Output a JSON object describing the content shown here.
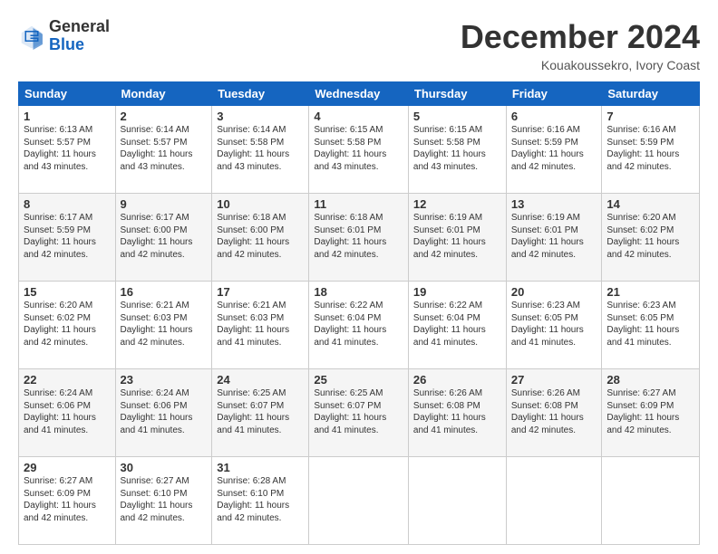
{
  "header": {
    "logo_general": "General",
    "logo_blue": "Blue",
    "month_title": "December 2024",
    "location": "Kouakoussekro, Ivory Coast"
  },
  "weekdays": [
    "Sunday",
    "Monday",
    "Tuesday",
    "Wednesday",
    "Thursday",
    "Friday",
    "Saturday"
  ],
  "weeks": [
    [
      {
        "day": "1",
        "info": "Sunrise: 6:13 AM\nSunset: 5:57 PM\nDaylight: 11 hours and 43 minutes."
      },
      {
        "day": "2",
        "info": "Sunrise: 6:14 AM\nSunset: 5:57 PM\nDaylight: 11 hours and 43 minutes."
      },
      {
        "day": "3",
        "info": "Sunrise: 6:14 AM\nSunset: 5:58 PM\nDaylight: 11 hours and 43 minutes."
      },
      {
        "day": "4",
        "info": "Sunrise: 6:15 AM\nSunset: 5:58 PM\nDaylight: 11 hours and 43 minutes."
      },
      {
        "day": "5",
        "info": "Sunrise: 6:15 AM\nSunset: 5:58 PM\nDaylight: 11 hours and 43 minutes."
      },
      {
        "day": "6",
        "info": "Sunrise: 6:16 AM\nSunset: 5:59 PM\nDaylight: 11 hours and 42 minutes."
      },
      {
        "day": "7",
        "info": "Sunrise: 6:16 AM\nSunset: 5:59 PM\nDaylight: 11 hours and 42 minutes."
      }
    ],
    [
      {
        "day": "8",
        "info": "Sunrise: 6:17 AM\nSunset: 5:59 PM\nDaylight: 11 hours and 42 minutes."
      },
      {
        "day": "9",
        "info": "Sunrise: 6:17 AM\nSunset: 6:00 PM\nDaylight: 11 hours and 42 minutes."
      },
      {
        "day": "10",
        "info": "Sunrise: 6:18 AM\nSunset: 6:00 PM\nDaylight: 11 hours and 42 minutes."
      },
      {
        "day": "11",
        "info": "Sunrise: 6:18 AM\nSunset: 6:01 PM\nDaylight: 11 hours and 42 minutes."
      },
      {
        "day": "12",
        "info": "Sunrise: 6:19 AM\nSunset: 6:01 PM\nDaylight: 11 hours and 42 minutes."
      },
      {
        "day": "13",
        "info": "Sunrise: 6:19 AM\nSunset: 6:01 PM\nDaylight: 11 hours and 42 minutes."
      },
      {
        "day": "14",
        "info": "Sunrise: 6:20 AM\nSunset: 6:02 PM\nDaylight: 11 hours and 42 minutes."
      }
    ],
    [
      {
        "day": "15",
        "info": "Sunrise: 6:20 AM\nSunset: 6:02 PM\nDaylight: 11 hours and 42 minutes."
      },
      {
        "day": "16",
        "info": "Sunrise: 6:21 AM\nSunset: 6:03 PM\nDaylight: 11 hours and 42 minutes."
      },
      {
        "day": "17",
        "info": "Sunrise: 6:21 AM\nSunset: 6:03 PM\nDaylight: 11 hours and 41 minutes."
      },
      {
        "day": "18",
        "info": "Sunrise: 6:22 AM\nSunset: 6:04 PM\nDaylight: 11 hours and 41 minutes."
      },
      {
        "day": "19",
        "info": "Sunrise: 6:22 AM\nSunset: 6:04 PM\nDaylight: 11 hours and 41 minutes."
      },
      {
        "day": "20",
        "info": "Sunrise: 6:23 AM\nSunset: 6:05 PM\nDaylight: 11 hours and 41 minutes."
      },
      {
        "day": "21",
        "info": "Sunrise: 6:23 AM\nSunset: 6:05 PM\nDaylight: 11 hours and 41 minutes."
      }
    ],
    [
      {
        "day": "22",
        "info": "Sunrise: 6:24 AM\nSunset: 6:06 PM\nDaylight: 11 hours and 41 minutes."
      },
      {
        "day": "23",
        "info": "Sunrise: 6:24 AM\nSunset: 6:06 PM\nDaylight: 11 hours and 41 minutes."
      },
      {
        "day": "24",
        "info": "Sunrise: 6:25 AM\nSunset: 6:07 PM\nDaylight: 11 hours and 41 minutes."
      },
      {
        "day": "25",
        "info": "Sunrise: 6:25 AM\nSunset: 6:07 PM\nDaylight: 11 hours and 41 minutes."
      },
      {
        "day": "26",
        "info": "Sunrise: 6:26 AM\nSunset: 6:08 PM\nDaylight: 11 hours and 41 minutes."
      },
      {
        "day": "27",
        "info": "Sunrise: 6:26 AM\nSunset: 6:08 PM\nDaylight: 11 hours and 42 minutes."
      },
      {
        "day": "28",
        "info": "Sunrise: 6:27 AM\nSunset: 6:09 PM\nDaylight: 11 hours and 42 minutes."
      }
    ],
    [
      {
        "day": "29",
        "info": "Sunrise: 6:27 AM\nSunset: 6:09 PM\nDaylight: 11 hours and 42 minutes."
      },
      {
        "day": "30",
        "info": "Sunrise: 6:27 AM\nSunset: 6:10 PM\nDaylight: 11 hours and 42 minutes."
      },
      {
        "day": "31",
        "info": "Sunrise: 6:28 AM\nSunset: 6:10 PM\nDaylight: 11 hours and 42 minutes."
      },
      null,
      null,
      null,
      null
    ]
  ]
}
